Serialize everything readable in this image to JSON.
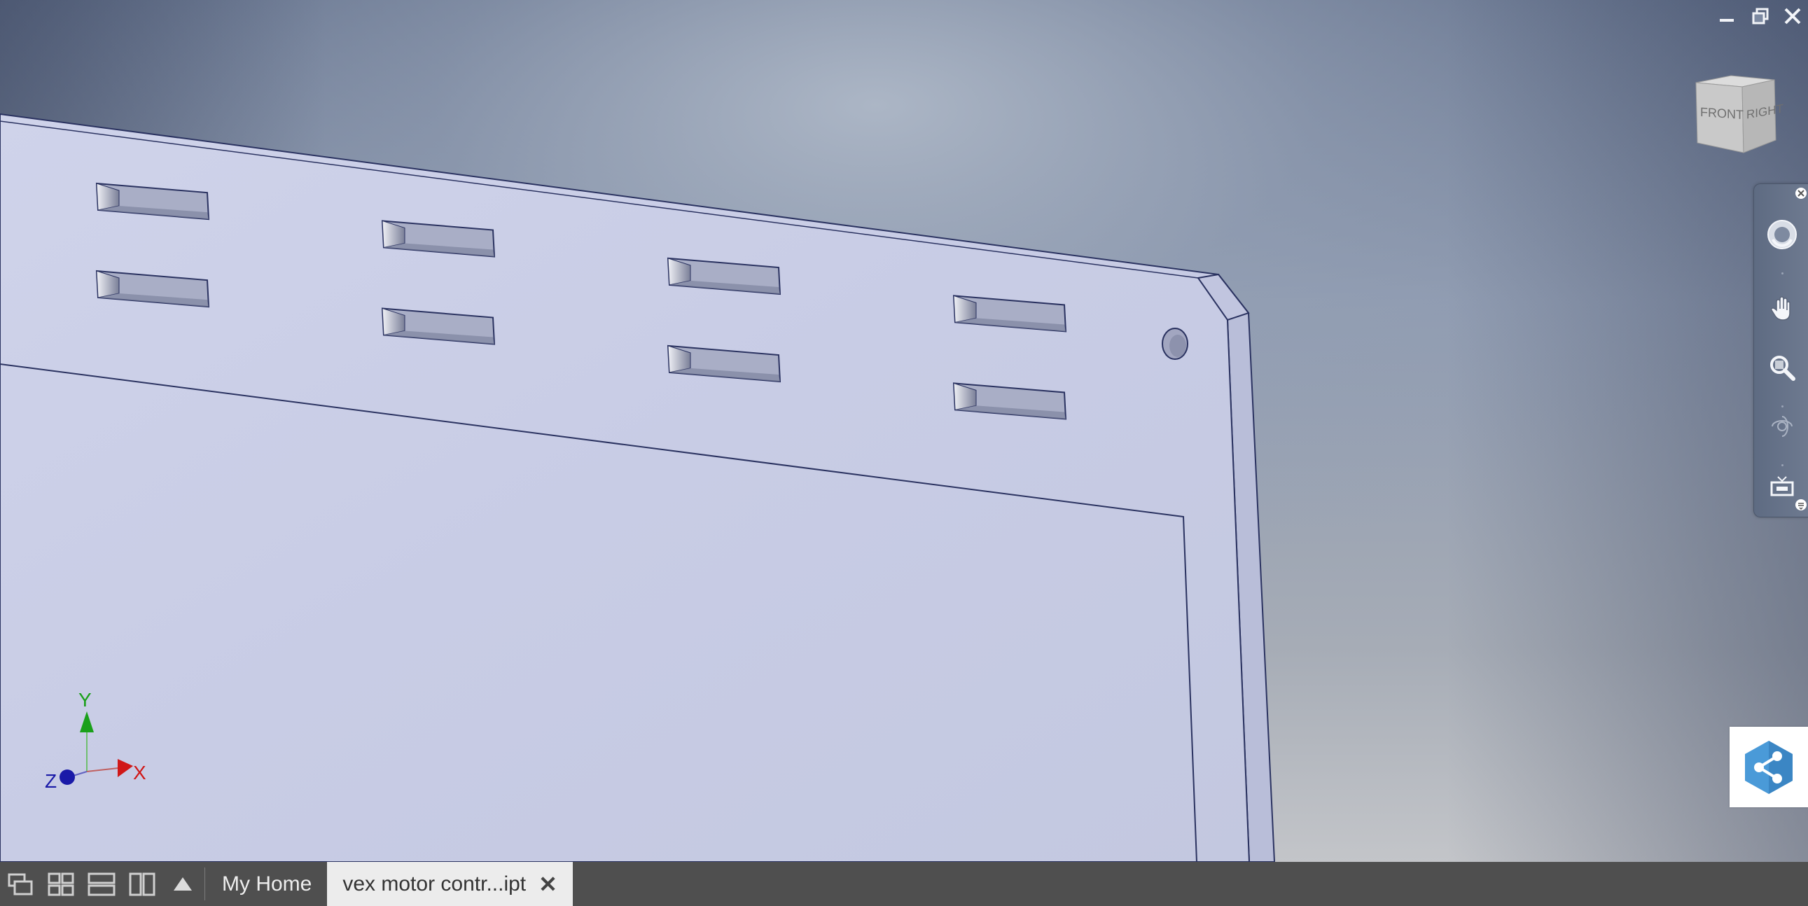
{
  "window_controls": {
    "minimize_icon": "minimize-icon",
    "restore_icon": "restore-icon",
    "close_icon": "close-icon"
  },
  "viewcube": {
    "front_label": "FRONT",
    "right_label": "RIGHT"
  },
  "navigation_bar": {
    "items": [
      {
        "name": "steering-wheel",
        "icon": "steering-wheel-icon"
      },
      {
        "name": "pan",
        "icon": "hand-pan-icon"
      },
      {
        "name": "zoom",
        "icon": "zoom-icon"
      },
      {
        "name": "orbit",
        "icon": "orbit-icon"
      },
      {
        "name": "look-at",
        "icon": "look-at-icon"
      }
    ]
  },
  "axis_triad": {
    "x_label": "X",
    "y_label": "Y",
    "z_label": "Z",
    "colors": {
      "x": "#d01818",
      "y": "#1aa01a",
      "z": "#1a1aa8"
    }
  },
  "tabbar": {
    "layout_buttons": [
      "cascade-windows-icon",
      "tile-grid-icon",
      "tile-horizontal-icon",
      "tile-vertical-icon",
      "expand-up-icon"
    ],
    "tabs": [
      {
        "label": "My Home",
        "active": false
      },
      {
        "label": "vex motor contr...ipt",
        "active": true,
        "closable": true
      }
    ],
    "close_symbol": "✕"
  },
  "colors": {
    "part_face": "#c9cde6",
    "part_edge": "#2a3260",
    "background_top": "#5c6a86",
    "background_bottom": "#c3c5c9",
    "tabbar": "#4f4f4f"
  }
}
